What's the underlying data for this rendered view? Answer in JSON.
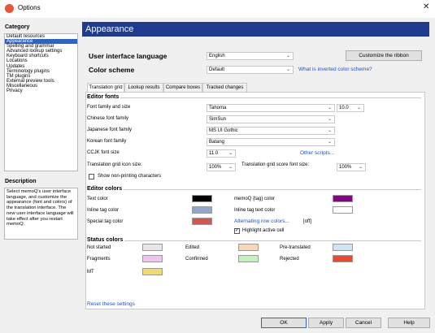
{
  "window": {
    "title": "Options",
    "close_glyph": "✕"
  },
  "sidebar": {
    "category_label": "Category",
    "items": [
      "Default resources",
      "Appearance",
      "Spelling and grammar",
      "Advanced lookup settings",
      "Keyboard shortcuts",
      "Locations",
      "Updates",
      "Terminology plugins",
      "TM plugins",
      "External preview tools",
      "Miscellaneous",
      "Privacy"
    ],
    "selected_index": 1,
    "description_label": "Description",
    "description_text": "Select memoQ's user interface language, and customize the appearance (font and colors) of the translation interface. The new user interface language will take effect after you restart memoQ."
  },
  "header": {
    "title": "Appearance"
  },
  "ui_language": {
    "label": "User interface language",
    "value": "English",
    "customize_button": "Customize the ribbon"
  },
  "color_scheme": {
    "label": "Color scheme",
    "value": "Default",
    "help_link": "What is inverted color scheme?"
  },
  "tabs": [
    "Translation grid",
    "Lookup results",
    "Compare boxes",
    "Tracked changes"
  ],
  "editor_fonts": {
    "title": "Editor fonts",
    "font_and_size_label": "Font family and size",
    "font_and_size_value": "Tahoma",
    "size_value": "10.0",
    "chinese_label": "Chinese font family",
    "chinese_value": "SimSun",
    "japanese_label": "Japanese font family",
    "japanese_value": "MS UI Gothic",
    "korean_label": "Korean font family",
    "korean_value": "Batang",
    "ccjk_label": "CCJK font size",
    "ccjk_value": "11.0",
    "other_scripts_link": "Other scripts...",
    "grid_icon_label": "Translation grid icon size:",
    "grid_icon_value": "100%",
    "grid_score_label": "Translation grid score font size:",
    "grid_score_value": "100%",
    "show_nonprinting_label": "Show non-printing characters",
    "show_nonprinting_checked": false
  },
  "editor_colors": {
    "title": "Editor colors",
    "text_color_label": "Text color",
    "text_color": "#000000",
    "inline_tag_label": "Inline tag color",
    "inline_tag_color": "#8fa6cf",
    "special_tag_label": "Special tag color",
    "special_tag_color": "#d9534f",
    "memoq_tag_label": "memoQ {tag} color",
    "memoq_tag_color": "#8b008b",
    "inline_tag_text_label": "Inline tag text color",
    "inline_tag_text_color": "#ffffff",
    "alternating_link": "Alternating row colors...",
    "alternating_state": "[off]",
    "highlight_label": "Highlight active cell",
    "highlight_checked": true
  },
  "status_colors": {
    "title": "Status colors",
    "not_started_label": "Not started",
    "not_started_color": "#e6e6e6",
    "edited_label": "Edited",
    "edited_color": "#fcd5b4",
    "pretranslated_label": "Pre-translated",
    "pretranslated_color": "#cde6f7",
    "fragments_label": "Fragments",
    "fragments_color": "#f4c2f0",
    "confirmed_label": "Confirmed",
    "confirmed_color": "#c5f0c0",
    "rejected_label": "Rejected",
    "rejected_color": "#f0472c",
    "mt_label": "MT",
    "mt_color": "#f0dc6a"
  },
  "reset_link": "Reset these settings",
  "footer": {
    "ok": "OK",
    "apply": "Apply",
    "cancel": "Cancel",
    "help": "Help"
  },
  "icons": {
    "app": "memoq-icon",
    "chevron": "chevron-down-icon",
    "check": "check-icon"
  }
}
